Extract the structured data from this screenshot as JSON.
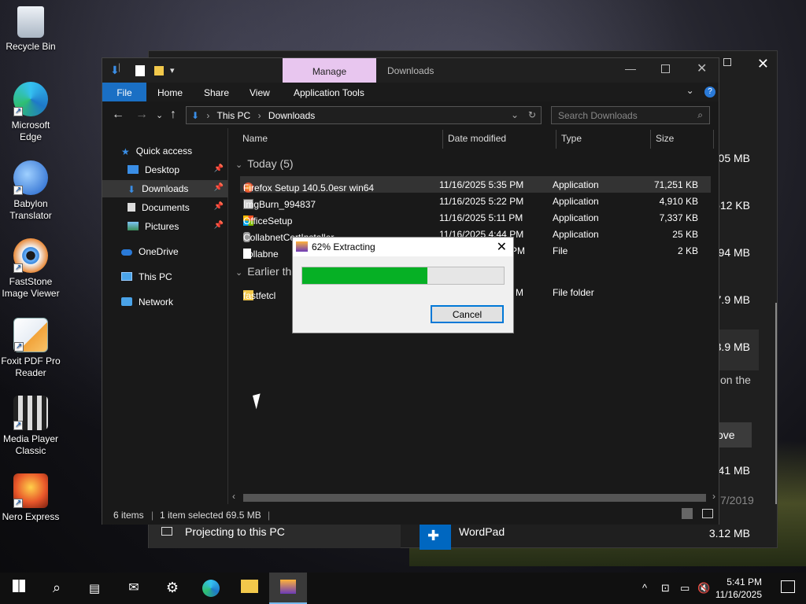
{
  "desktop": {
    "icons": [
      {
        "label": "Recycle Bin",
        "icon": "recycle-bin-icon",
        "color": "#cfd8e3"
      },
      {
        "label": "Microsoft Edge",
        "icon": "edge-icon",
        "color": "#1f9ed8"
      },
      {
        "label": "Babylon Translator",
        "icon": "babylon-icon",
        "color": "#2b6fd1"
      },
      {
        "label": "FastStone Image Viewer",
        "icon": "faststone-icon",
        "color": "#e05a2b"
      },
      {
        "label": "Foxit PDF Pro Reader",
        "icon": "foxit-icon",
        "color": "#f2a33a"
      },
      {
        "label": "Media Player Classic",
        "icon": "mpc-icon",
        "color": "#888888"
      },
      {
        "label": "Nero Express",
        "icon": "nero-icon",
        "color": "#e8572a"
      }
    ]
  },
  "background_window": {
    "sizes": [
      "05 MB",
      "612 KB",
      "94 MB",
      "7.9 MB",
      "3.9 MB",
      "41 MB",
      "3.12 MB"
    ],
    "text_fragment": "on the",
    "button_fragment": "ove",
    "date_fragment": "7/2019",
    "projecting_label": "Projecting to this PC",
    "wordpad_label": "WordPad"
  },
  "explorer": {
    "title": "Downloads",
    "manage_tab": "Manage",
    "ribbon_tabs": [
      "File",
      "Home",
      "Share",
      "View",
      "Application Tools"
    ],
    "breadcrumb": [
      "This PC",
      "Downloads"
    ],
    "search_placeholder": "Search Downloads",
    "nav": [
      {
        "label": "Quick access",
        "icon": "star-icon",
        "pinned": false,
        "selected": false
      },
      {
        "label": "Desktop",
        "icon": "desktop-folder-icon",
        "pinned": true,
        "selected": false
      },
      {
        "label": "Downloads",
        "icon": "download-arrow-icon",
        "pinned": true,
        "selected": true
      },
      {
        "label": "Documents",
        "icon": "documents-icon",
        "pinned": true,
        "selected": false
      },
      {
        "label": "Pictures",
        "icon": "pictures-icon",
        "pinned": true,
        "selected": false
      },
      {
        "label": "OneDrive",
        "icon": "onedrive-cloud-icon",
        "pinned": false,
        "selected": false
      },
      {
        "label": "This PC",
        "icon": "computer-icon",
        "pinned": false,
        "selected": false
      },
      {
        "label": "Network",
        "icon": "network-icon",
        "pinned": false,
        "selected": false
      }
    ],
    "columns": [
      "Name",
      "Date modified",
      "Type",
      "Size"
    ],
    "groups": [
      "Today (5)",
      "Earlier th"
    ],
    "files": [
      {
        "name": "Firefox Setup 140.5.0esr win64",
        "date": "11/16/2025 5:35 PM",
        "type": "Application",
        "size": "71,251 KB",
        "icon": "firefox-icon",
        "selected": true
      },
      {
        "name": "ImgBurn_994837",
        "date": "11/16/2025 5:22 PM",
        "type": "Application",
        "size": "4,910 KB",
        "icon": "imgburn-icon",
        "selected": false
      },
      {
        "name": "OfficeSetup",
        "date": "11/16/2025 5:11 PM",
        "type": "Application",
        "size": "7,337 KB",
        "icon": "office-icon",
        "selected": false
      },
      {
        "name": "CollabnetCertInstaller",
        "date": "11/16/2025 4:44 PM",
        "type": "Application",
        "size": "25 KB",
        "icon": "installer-icon",
        "selected": false
      },
      {
        "name": "collabne",
        "date": "PM",
        "type": "File",
        "size": "2 KB",
        "icon": "file-icon",
        "selected": false
      }
    ],
    "earlier_files": [
      {
        "name": "fastfetcl",
        "date": "M",
        "type": "File folder",
        "size": "",
        "icon": "folder-icon"
      }
    ],
    "status": {
      "count": "6 items",
      "selected": "1 item selected  69.5 MB"
    }
  },
  "extract_dialog": {
    "title": "62% Extracting",
    "progress": 0.62,
    "cancel_label": "Cancel"
  },
  "taskbar": {
    "time": "5:41 PM",
    "date": "11/16/2025"
  }
}
